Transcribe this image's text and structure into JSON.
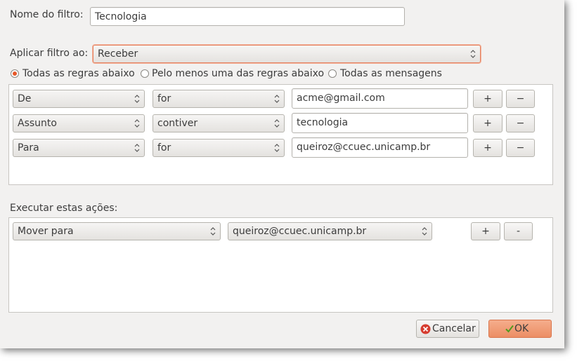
{
  "filter_name": {
    "label": "Nome do filtro:",
    "value": "Tecnologia"
  },
  "apply_filter": {
    "label": "Aplicar filtro ao:",
    "value": "Receber"
  },
  "match_options": [
    {
      "label": "Todas as regras abaixo",
      "selected": true
    },
    {
      "label": "Pelo menos uma das regras abaixo",
      "selected": false
    },
    {
      "label": "Todas as mensagens",
      "selected": false
    }
  ],
  "rules": [
    {
      "field": "De",
      "operator": "for",
      "value": "acme@gmail.com",
      "add": "+",
      "remove": "−"
    },
    {
      "field": "Assunto",
      "operator": "contiver",
      "value": "tecnologia",
      "add": "+",
      "remove": "−"
    },
    {
      "field": "Para",
      "operator": "for",
      "value": "queiroz@ccuec.unicamp.br",
      "add": "+",
      "remove": "−"
    }
  ],
  "actions": {
    "label": "Executar estas ações:",
    "items": [
      {
        "action": "Mover para",
        "target": "queiroz@ccuec.unicamp.br",
        "add": "+",
        "remove": "-"
      }
    ]
  },
  "buttons": {
    "cancel": "Cancelar",
    "ok": "OK"
  },
  "colors": {
    "accent": "#e5582a",
    "ok_bg": "#f09b74",
    "dialog_bg": "#f2f1f0"
  }
}
